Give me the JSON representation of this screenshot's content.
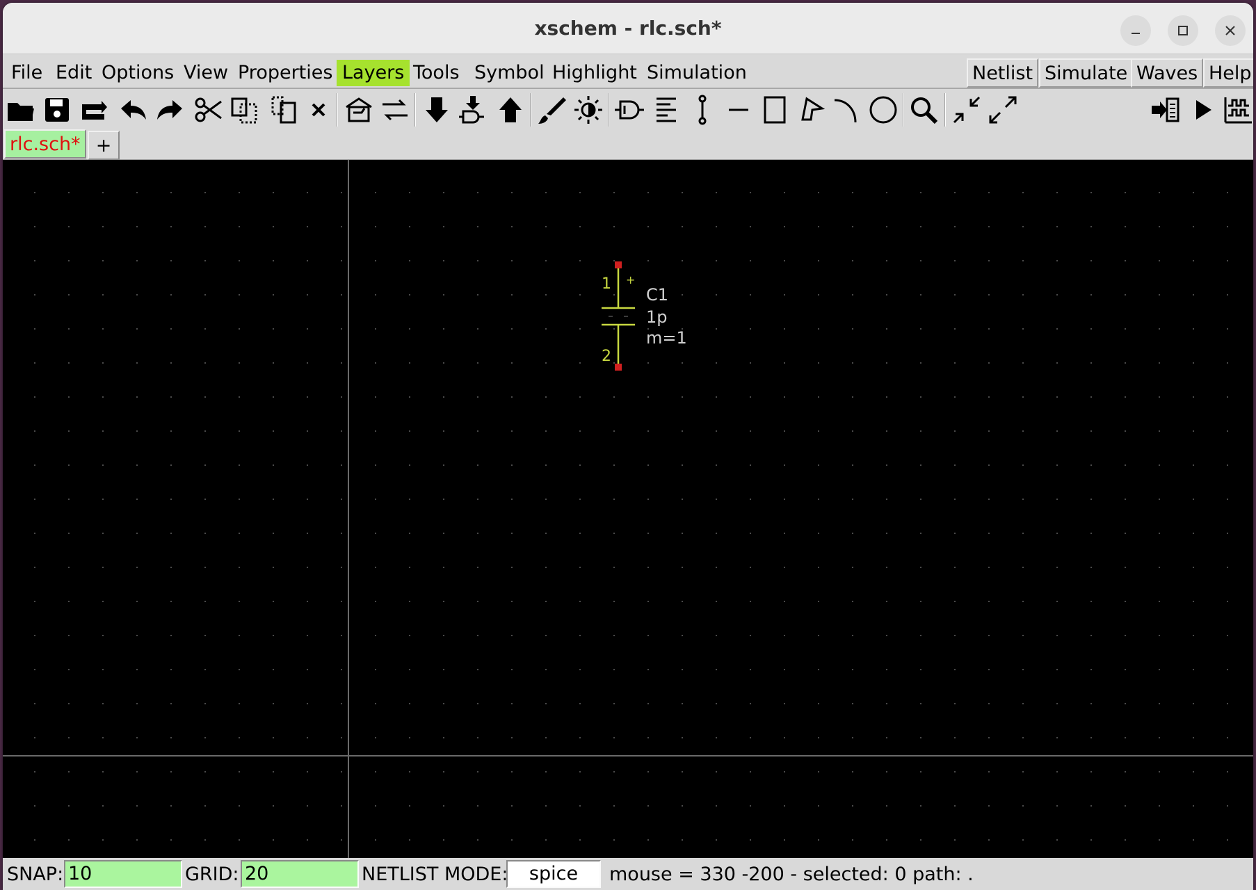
{
  "window": {
    "title": "xschem - rlc.sch*"
  },
  "menubar": {
    "items": [
      "File",
      "Edit",
      "Options",
      "View",
      "Properties",
      "Layers",
      "Tools",
      "Symbol",
      "Highlight",
      "Simulation"
    ],
    "active": "Layers",
    "right_buttons": [
      "Netlist",
      "Simulate",
      "Waves",
      "Help"
    ]
  },
  "toolbar": {
    "icons": [
      "open-icon",
      "save-icon",
      "reload-icon",
      "undo-icon",
      "redo-icon",
      "cut-icon",
      "copy-icon",
      "paste-icon",
      "delete-icon",
      "insert-symbol-icon",
      "flip-icon",
      "descend-icon",
      "descend-symbol-icon",
      "go-back-icon",
      "draw-icon",
      "highlight-icon",
      "symbol-gate-icon",
      "align-icon",
      "wire-icon",
      "line-icon",
      "rect-icon",
      "polygon-icon",
      "arc-icon",
      "circle-icon",
      "zoom-icon",
      "zoom-in-icon",
      "zoom-out-icon",
      "netlist-icon",
      "simulate-icon",
      "waves-icon"
    ]
  },
  "tabs": {
    "items": [
      "rlc.sch*"
    ],
    "add_label": "+"
  },
  "schematic": {
    "component": {
      "name": "C1",
      "value": "1p",
      "multiplier": "m=1",
      "pin1": "1",
      "pin2": "2",
      "polarity": "+"
    },
    "colors": {
      "background": "#000000",
      "wire": "#c8d840",
      "pin": "#d02020",
      "text": "#d0d0d0",
      "pin_label": "#c8d840"
    }
  },
  "statusbar": {
    "snap_label": "SNAP:",
    "snap_value": "10",
    "grid_label": "GRID:",
    "grid_value": "20",
    "netlist_mode_label": "NETLIST MODE:",
    "netlist_mode_value": "spice",
    "info": "mouse = 330 -200 - selected: 0 path: ."
  },
  "colors": {
    "accent": "#a6e22e",
    "field_bg": "#aaf59e",
    "tab_active_text": "#e01010"
  }
}
